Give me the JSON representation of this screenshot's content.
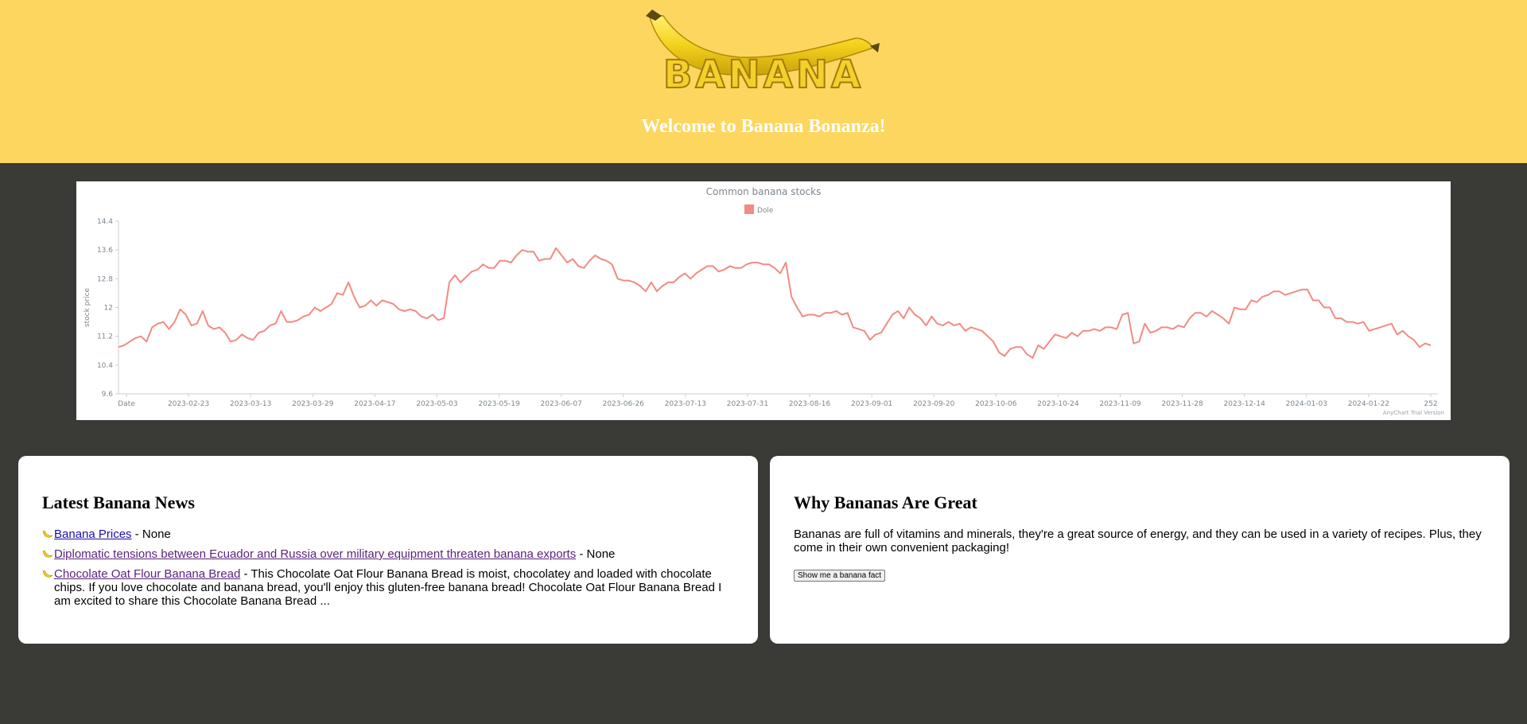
{
  "header": {
    "logo_text": "BANANA",
    "welcome": "Welcome to Banana Bonanza!"
  },
  "chart_data": {
    "type": "line",
    "title": "Common banana stocks",
    "ylabel": "stock price",
    "xlabel": "",
    "ylim": [
      9.6,
      14.4
    ],
    "yticks": [
      "9.6",
      "10.4",
      "11.2",
      "12",
      "12.8",
      "13.6",
      "14.4"
    ],
    "xtick_labels": [
      "Date",
      "2023-02-23",
      "2023-03-13",
      "2023-03-29",
      "2023-04-17",
      "2023-05-03",
      "2023-05-19",
      "2023-06-07",
      "2023-06-26",
      "2023-07-13",
      "2023-07-31",
      "2023-08-16",
      "2023-09-01",
      "2023-09-20",
      "2023-10-06",
      "2023-10-24",
      "2023-11-09",
      "2023-11-28",
      "2023-12-14",
      "2024-01-03",
      "2024-01-22",
      "252"
    ],
    "legend": "top-center",
    "watermark": "AnyChart Trial Version",
    "grid": false,
    "series": [
      {
        "name": "Dole",
        "color": "#f28b82",
        "values": [
          10.9,
          10.95,
          11.05,
          11.15,
          11.2,
          11.05,
          11.45,
          11.55,
          11.6,
          11.4,
          11.6,
          11.95,
          11.8,
          11.5,
          11.55,
          11.9,
          11.5,
          11.4,
          11.45,
          11.3,
          11.05,
          11.1,
          11.25,
          11.15,
          11.1,
          11.3,
          11.35,
          11.5,
          11.55,
          11.9,
          11.6,
          11.6,
          11.65,
          11.75,
          11.8,
          12.0,
          11.9,
          12.0,
          12.1,
          12.4,
          12.35,
          12.7,
          12.3,
          12.0,
          12.05,
          12.2,
          12.05,
          12.2,
          12.15,
          12.1,
          11.95,
          11.9,
          11.95,
          11.9,
          11.75,
          11.7,
          11.8,
          11.65,
          11.7,
          12.7,
          12.9,
          12.7,
          12.85,
          13.0,
          13.05,
          13.2,
          13.1,
          13.1,
          13.3,
          13.3,
          13.25,
          13.45,
          13.6,
          13.55,
          13.55,
          13.3,
          13.35,
          13.35,
          13.65,
          13.45,
          13.25,
          13.35,
          13.15,
          13.1,
          13.3,
          13.45,
          13.35,
          13.3,
          13.2,
          12.8,
          12.75,
          12.75,
          12.7,
          12.6,
          12.45,
          12.7,
          12.45,
          12.6,
          12.7,
          12.7,
          12.85,
          12.95,
          12.8,
          12.95,
          13.05,
          13.15,
          13.15,
          13.0,
          13.05,
          13.15,
          13.1,
          13.1,
          13.2,
          13.25,
          13.25,
          13.2,
          13.2,
          13.1,
          12.95,
          13.25,
          12.3,
          12.0,
          11.75,
          11.8,
          11.8,
          11.75,
          11.85,
          11.85,
          11.9,
          11.8,
          11.85,
          11.45,
          11.4,
          11.35,
          11.1,
          11.25,
          11.3,
          11.55,
          11.8,
          11.9,
          11.7,
          12.0,
          11.8,
          11.7,
          11.5,
          11.75,
          11.55,
          11.5,
          11.6,
          11.5,
          11.55,
          11.35,
          11.45,
          11.4,
          11.35,
          11.2,
          11.05,
          10.75,
          10.65,
          10.85,
          10.9,
          10.9,
          10.7,
          10.6,
          10.95,
          10.85,
          11.05,
          11.25,
          11.2,
          11.15,
          11.3,
          11.2,
          11.35,
          11.35,
          11.4,
          11.35,
          11.45,
          11.45,
          11.4,
          11.8,
          11.85,
          11.0,
          11.05,
          11.55,
          11.3,
          11.35,
          11.45,
          11.45,
          11.4,
          11.5,
          11.45,
          11.7,
          11.85,
          11.85,
          11.75,
          11.9,
          11.8,
          11.7,
          11.55,
          12.0,
          11.95,
          11.95,
          12.2,
          12.15,
          12.3,
          12.35,
          12.45,
          12.45,
          12.35,
          12.4,
          12.45,
          12.5,
          12.5,
          12.2,
          12.2,
          12.0,
          12.0,
          11.7,
          11.7,
          11.6,
          11.6,
          11.55,
          11.6,
          11.35,
          11.4,
          11.45,
          11.5,
          11.55,
          11.25,
          11.35,
          11.2,
          11.1,
          10.9,
          11.0,
          10.95
        ]
      }
    ]
  },
  "news": {
    "title": "Latest Banana News",
    "items": [
      {
        "link": "Banana Prices",
        "suffix": " - None"
      },
      {
        "link": "Diplomatic tensions between Ecuador and Russia over military equipment threaten banana exports",
        "suffix": " - None"
      },
      {
        "link": "Chocolate Oat Flour Banana Bread",
        "suffix": " - This Chocolate Oat Flour Banana Bread is moist, chocolatey and loaded with chocolate chips. If you love chocolate and banana bread, you'll enjoy this gluten-free banana bread! Chocolate Oat Flour Banana Bread I am excited to share this Chocolate Banana Bread ..."
      }
    ]
  },
  "why": {
    "title": "Why Bananas Are Great",
    "text": "Bananas are full of vitamins and minerals, they're a great source of energy, and they can be used in a variety of recipes. Plus, they come in their own convenient packaging!",
    "button": "Show me a banana fact"
  },
  "colors": {
    "header_bg": "#fdd660",
    "page_bg": "#3a3a36",
    "line": "#f28b82",
    "link": "#1a0dab",
    "visited_link": "#5a237d"
  },
  "icons": [
    "banana-logo",
    "banana-bullet-icon"
  ]
}
